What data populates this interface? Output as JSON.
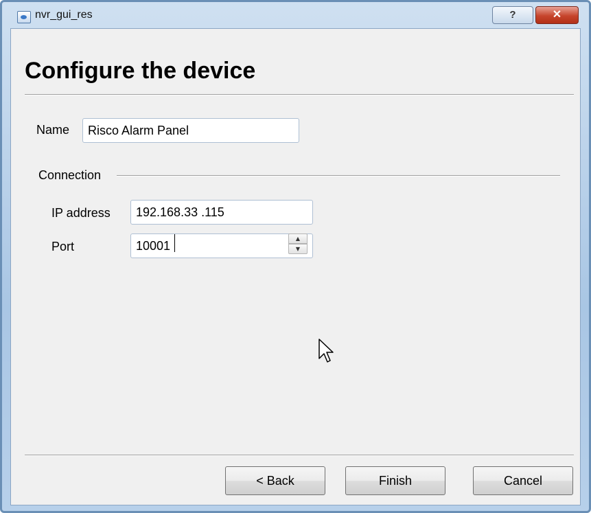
{
  "window": {
    "title": "nvr_gui_res"
  },
  "titlebar": {
    "help_label": "?",
    "close_label": "✕"
  },
  "page": {
    "title": "Configure the device"
  },
  "form": {
    "name_label": "Name",
    "name_value": "Risco Alarm Panel",
    "connection_label": "Connection",
    "ip_label": "IP address",
    "ip_value": "192.168.33 .115",
    "port_label": "Port",
    "port_value": "10001"
  },
  "buttons": {
    "back": "< Back",
    "finish": "Finish",
    "cancel": "Cancel"
  },
  "icons": {
    "app": "app-window-icon",
    "spin_up": "spin-up-icon",
    "spin_down": "spin-down-icon",
    "cursor": "mouse-pointer-icon"
  },
  "colors": {
    "close_button": "#c6452c",
    "frame": "#a9c6e4"
  }
}
